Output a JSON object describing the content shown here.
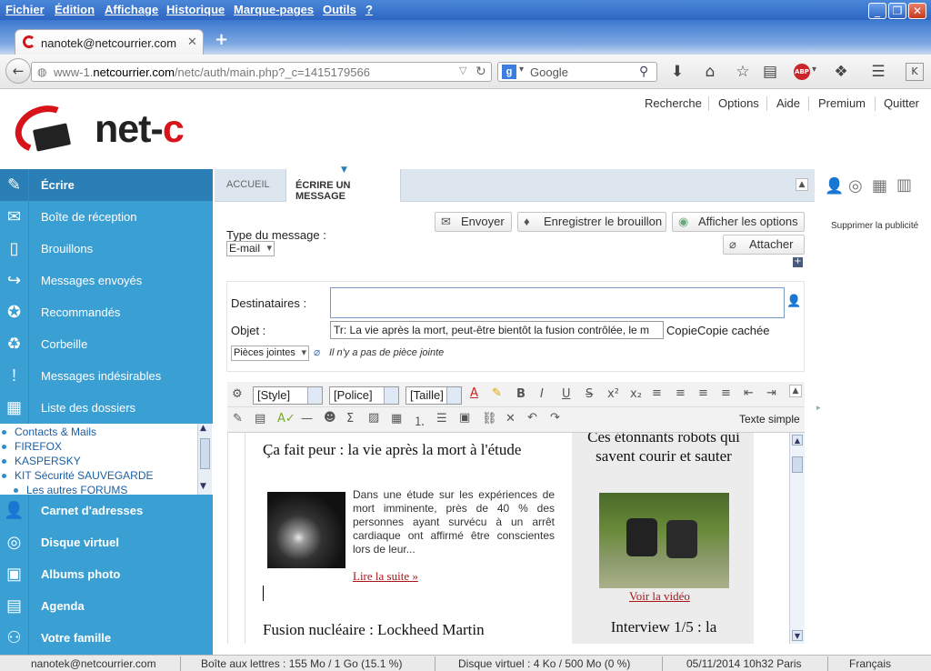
{
  "menubar": {
    "items": [
      "Fichier",
      "Édition",
      "Affichage",
      "Historique",
      "Marque-pages",
      "Outils",
      "?"
    ]
  },
  "browser": {
    "tab_title": "nanotek@netcourrier.com",
    "url_prefix": "www-1.",
    "url_domain": "netcourrier.com",
    "url_path": "/netc/auth/main.php?_c=1415179566",
    "search_engine": "Google"
  },
  "topnav": [
    "Recherche",
    "Options",
    "Aide",
    "Premium",
    "Quitter"
  ],
  "logo_text": "net-c",
  "sidebar": {
    "items": [
      {
        "label": "Écrire",
        "icon": "pencil-icon"
      },
      {
        "label": "Boîte de réception",
        "icon": "envelope-icon"
      },
      {
        "label": "Brouillons",
        "icon": "draft-icon"
      },
      {
        "label": "Messages envoyés",
        "icon": "send-arrow-icon"
      },
      {
        "label": "Recommandés",
        "icon": "ribbon-icon"
      },
      {
        "label": "Corbeille",
        "icon": "recycle-bin-icon"
      },
      {
        "label": "Messages indésirables",
        "icon": "warning-icon"
      },
      {
        "label": "Liste des dossiers",
        "icon": "grid-icon"
      }
    ],
    "folders": [
      "Contacts & Mails",
      "FIREFOX",
      "KASPERSKY",
      "KIT Sécurité SAUVEGARDE",
      "Les autres FORUMS"
    ],
    "bottom_items": [
      {
        "label": "Carnet d'adresses",
        "icon": "person-icon"
      },
      {
        "label": "Disque virtuel",
        "icon": "disk-icon"
      },
      {
        "label": "Albums photo",
        "icon": "photo-icon"
      },
      {
        "label": "Agenda",
        "icon": "calendar-icon"
      },
      {
        "label": "Votre famille",
        "icon": "family-icon"
      }
    ]
  },
  "tabs": {
    "home": "ACCUEIL",
    "compose": "ÉCRIRE UN MESSAGE"
  },
  "compose": {
    "send": "Envoyer",
    "save_draft": "Enregistrer le brouillon",
    "show_options": "Afficher les options",
    "attach": "Attacher",
    "type_label": "Type du message :",
    "type_value": "E-mail",
    "recipients_label": "Destinataires :",
    "recipients_value": "",
    "subject_label": "Objet :",
    "subject_value": "Tr: La vie après la mort, peut-être bientôt la fusion contrôlée, le m",
    "cc_link": "Copie",
    "bcc_link": "Copie cachée",
    "attachments_select": "Pièces jointes",
    "no_attachment": "Il n'y a pas de pièce jointe"
  },
  "editor_toolbar": {
    "style": "[Style]",
    "font": "[Police]",
    "size": "[Taille]",
    "plain_text": "Texte simple"
  },
  "editor_content": {
    "article1_title": "Ça fait peur : la vie après la mort à l'étude",
    "article1_body": "Dans une étude sur les expériences de mort imminente, près de 40 % des personnes ayant survécu à un arrêt cardiaque ont affirmé être conscientes lors de leur...",
    "read_more": "Lire la suite »",
    "article2_title": "Fusion nucléaire : Lockheed Martin",
    "side1_title": "Ces étonnants robots qui savent courir et sauter",
    "video_link": "Voir la vidéo",
    "side2_title": "Interview 1/5 : la"
  },
  "right_panel": {
    "remove_ads": "Supprimer la publicité"
  },
  "statusbar": {
    "user": "nanotek@netcourrier.com",
    "mailbox": "Boîte aux lettres : 155 Mo / 1 Go (15.1 %)",
    "virtual_disk": "Disque virtuel : 4 Ko / 500 Mo (0 %)",
    "datetime": "05/11/2014 10h32 Paris",
    "language": "Français"
  },
  "colors": {
    "sidebar": "#3a9fd3",
    "sidebar_active": "#2a7fb6",
    "brand_red": "#d7141a",
    "link_red": "#a8161b"
  }
}
